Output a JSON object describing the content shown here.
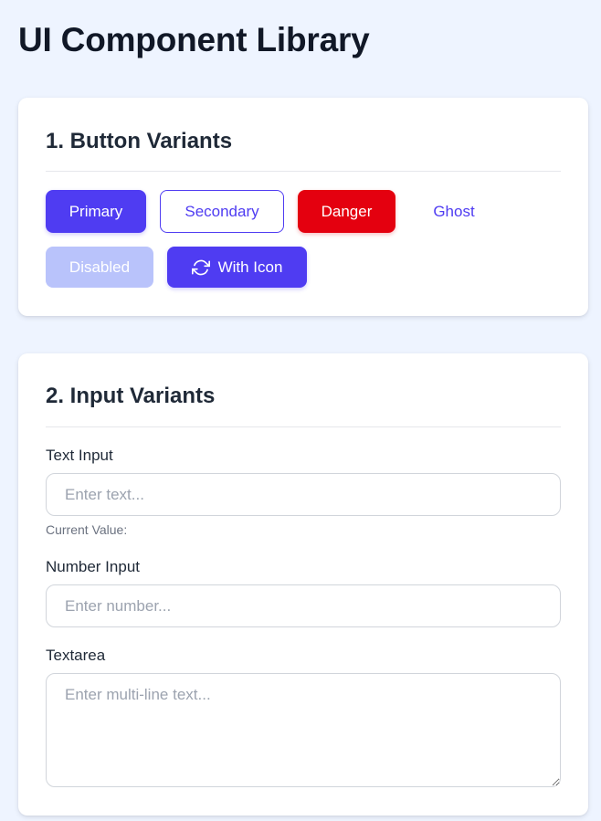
{
  "page": {
    "title": "UI Component Library"
  },
  "buttons_section": {
    "title": "1. Button Variants",
    "primary_label": "Primary",
    "secondary_label": "Secondary",
    "danger_label": "Danger",
    "ghost_label": "Ghost",
    "disabled_label": "Disabled",
    "with_icon_label": "With Icon",
    "with_icon_icon": "refresh-icon"
  },
  "inputs_section": {
    "title": "2. Input Variants",
    "text_input": {
      "label": "Text Input",
      "placeholder": "Enter text...",
      "value": "",
      "current_value_label": "Current Value:"
    },
    "number_input": {
      "label": "Number Input",
      "placeholder": "Enter number...",
      "value": ""
    },
    "textarea": {
      "label": "Textarea",
      "placeholder": "Enter multi-line text...",
      "value": ""
    }
  },
  "colors": {
    "background": "#eef4ff",
    "accent": "#4f3cf2",
    "danger": "#e4000f",
    "disabled": "#b9c3fb"
  }
}
